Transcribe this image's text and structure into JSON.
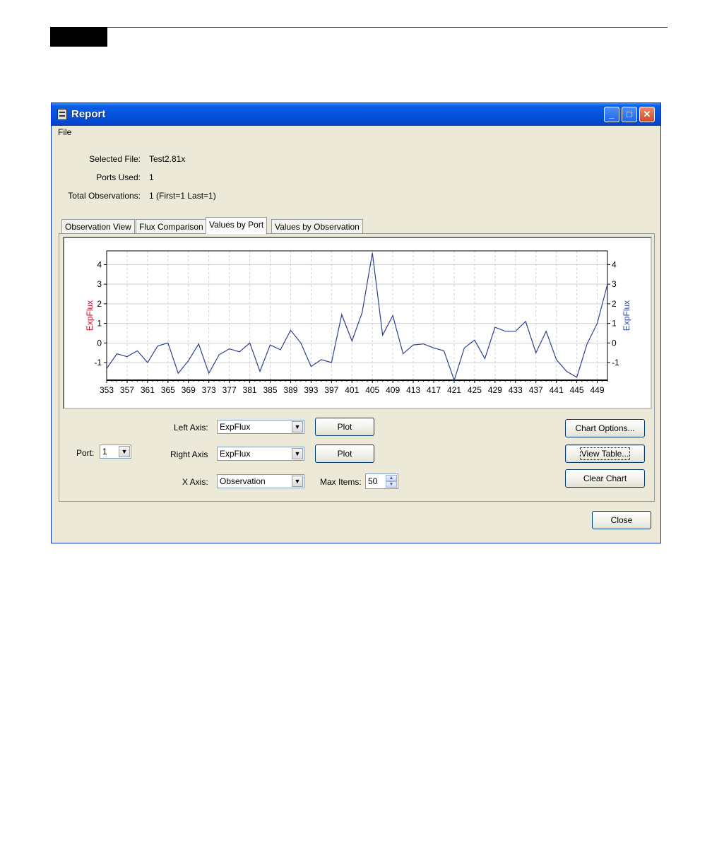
{
  "window": {
    "title": "Report"
  },
  "menu": {
    "file": "File"
  },
  "info": {
    "selected_file_label": "Selected File:",
    "selected_file_value": "Test2.81x",
    "ports_used_label": "Ports Used:",
    "ports_used_value": "1",
    "total_obs_label": "Total Observations:",
    "total_obs_value": "1 (First=1 Last=1)"
  },
  "tabs": [
    {
      "label": "Observation View"
    },
    {
      "label": "Flux Comparison"
    },
    {
      "label": "Values by Port"
    },
    {
      "label": "Values by Observation"
    }
  ],
  "controls": {
    "port_label": "Port:",
    "port_value": "1",
    "left_axis_label": "Left Axis:",
    "left_axis_value": "ExpFlux",
    "right_axis_label": "Right Axis",
    "right_axis_value": "ExpFlux",
    "x_axis_label": "X Axis:",
    "x_axis_value": "Observation",
    "max_items_label": "Max Items:",
    "max_items_value": "50",
    "plot_label": "Plot",
    "chart_options_label": "Chart Options...",
    "view_table_label": "View Table...",
    "clear_chart_label": "Clear Chart",
    "close_label": "Close"
  },
  "colors": {
    "series_line": "#2f3f8f",
    "left_axis_title": "#d0102a",
    "right_axis_title": "#3a4ea8"
  },
  "chart_data": {
    "type": "line",
    "xlabel_left": "ExpFlux",
    "ylabel": "ExpFlux",
    "ylabel_right": "ExpFlux",
    "xlim": [
      353,
      451
    ],
    "ylim": [
      -1.9,
      4.7
    ],
    "x_ticks": [
      353,
      357,
      361,
      365,
      369,
      373,
      377,
      381,
      385,
      389,
      393,
      397,
      401,
      405,
      409,
      413,
      417,
      421,
      425,
      429,
      433,
      437,
      441,
      445,
      449
    ],
    "y_ticks": [
      -1,
      0,
      1,
      2,
      3,
      4
    ],
    "grid": true,
    "series": [
      {
        "x": [
          353,
          355,
          357,
          359,
          361,
          363,
          365,
          367,
          369,
          371,
          373,
          375,
          377,
          379,
          381,
          383,
          385,
          387,
          389,
          391,
          393,
          395,
          397,
          399,
          401,
          403,
          405,
          407,
          409,
          411,
          413,
          415,
          417,
          419,
          421,
          423,
          425,
          427,
          429,
          431,
          433,
          435,
          437,
          439,
          441,
          443,
          445,
          447,
          449,
          451
        ],
        "values": [
          -1.3,
          -0.55,
          -0.7,
          -0.4,
          -1.0,
          -0.15,
          0.0,
          -1.55,
          -0.9,
          -0.05,
          -1.55,
          -0.6,
          -0.3,
          -0.45,
          0.0,
          -1.45,
          -0.1,
          -0.35,
          0.65,
          0.0,
          -1.2,
          -0.85,
          -1.0,
          1.45,
          0.1,
          1.55,
          4.6,
          0.4,
          1.4,
          -0.55,
          -0.1,
          -0.05,
          -0.25,
          -0.4,
          -1.9,
          -0.25,
          0.15,
          -0.8,
          0.8,
          0.6,
          0.6,
          1.1,
          -0.5,
          0.6,
          -0.85,
          -1.45,
          -1.75,
          -0.05,
          1.0,
          3.0
        ]
      }
    ]
  }
}
